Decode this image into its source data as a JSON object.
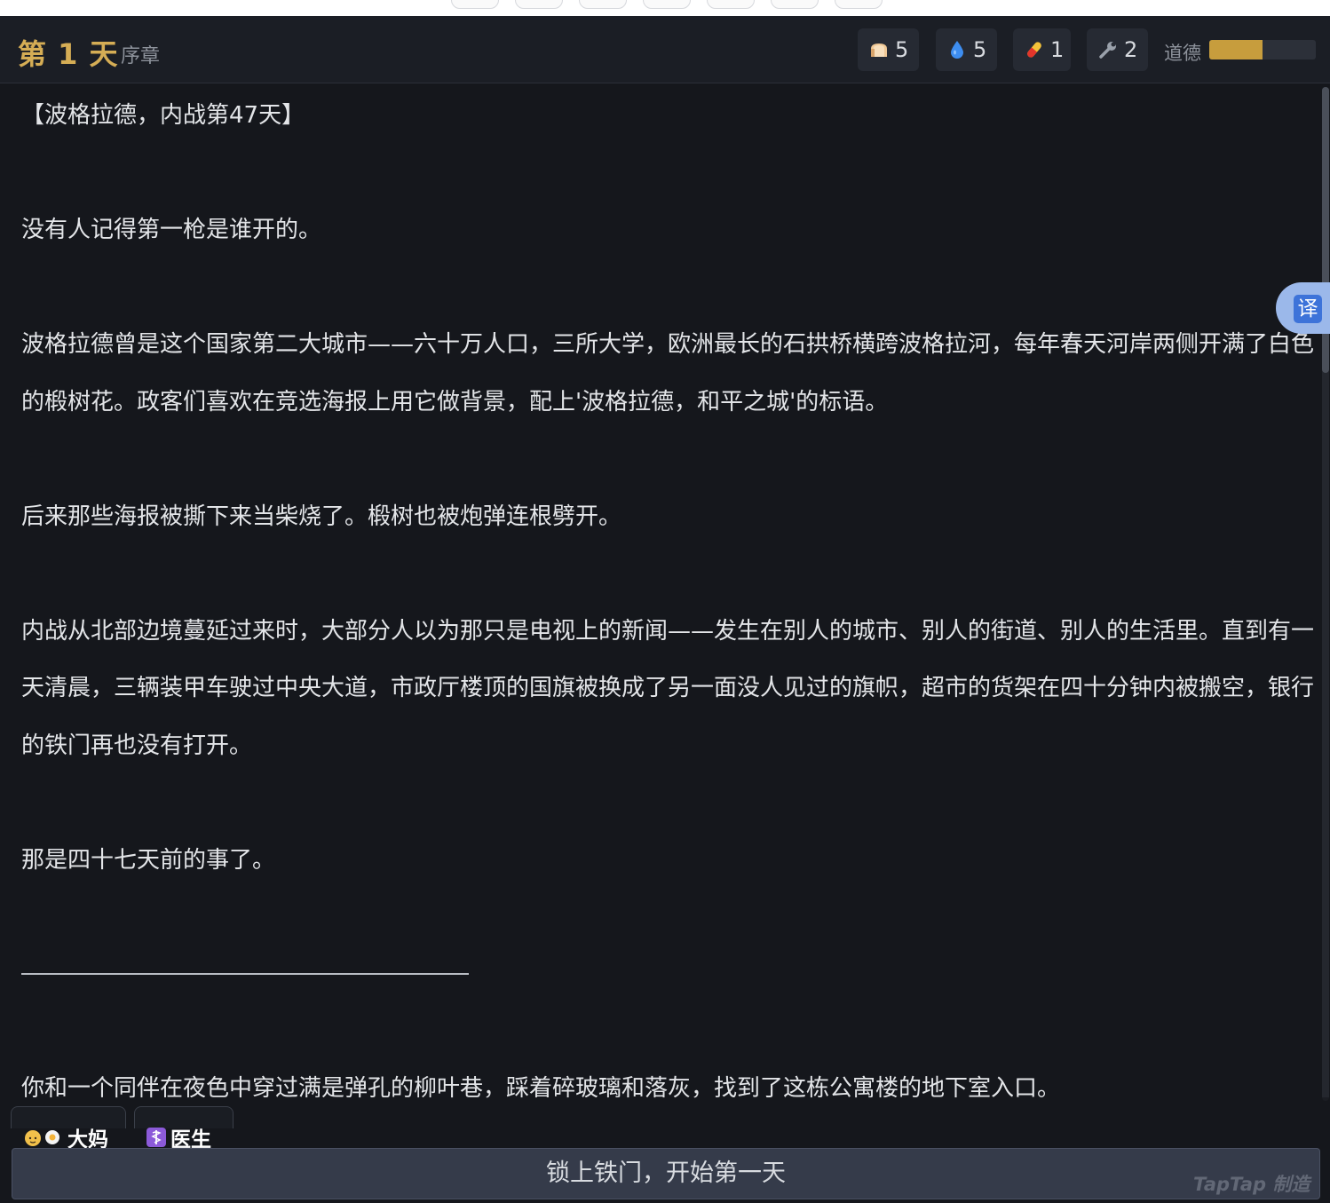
{
  "header": {
    "day_title": "第 1 天",
    "chapter": "序章",
    "resources": [
      {
        "icon": "bread-icon",
        "value": "5"
      },
      {
        "icon": "water-drop-icon",
        "value": "5"
      },
      {
        "icon": "medicine-pill-icon",
        "value": "1"
      },
      {
        "icon": "wrench-icon",
        "value": "2"
      }
    ],
    "morale_label": "道德",
    "morale_level": 0.5
  },
  "story": {
    "p1": "【波格拉德，内战第47天】",
    "p2": "没有人记得第一枪是谁开的。",
    "p3": "波格拉德曾是这个国家第二大城市——六十万人口，三所大学，欧洲最长的石拱桥横跨波格拉河，每年春天河岸两侧开满了白色的椴树花。政客们喜欢在竞选海报上用它做背景，配上'波格拉德，和平之城'的标语。",
    "p4": "后来那些海报被撕下来当柴烧了。椴树也被炮弹连根劈开。",
    "p5": "内战从北部边境蔓延过来时，大部分人以为那只是电视上的新闻——发生在别人的城市、别人的街道、别人的生活里。直到有一天清晨，三辆装甲车驶过中央大道，市政厅楼顶的国旗被换成了另一面没人见过的旗帜，超市的货架在四十分钟内被搬空，银行的铁门再也没有打开。",
    "p6": "那是四十七天前的事了。",
    "p7": "你和一个同伴在夜色中穿过满是弹孔的柳叶巷，踩着碎玻璃和落灰，找到了这栋公寓楼的地下室入口。"
  },
  "translate_label": "译",
  "characters": [
    {
      "name": "大妈",
      "icon": "elderly-woman-icon"
    },
    {
      "name": "医生",
      "icon": "medical-caduceus-icon"
    }
  ],
  "action_button": "锁上铁门，开始第一天",
  "watermark": "TapTap 制造",
  "colors": {
    "accent_gold": "#d5ad55",
    "background": "#15171c",
    "header_bg": "#1b1e25",
    "button_bg": "#353b4a",
    "translate_blue": "#3d73d9"
  }
}
